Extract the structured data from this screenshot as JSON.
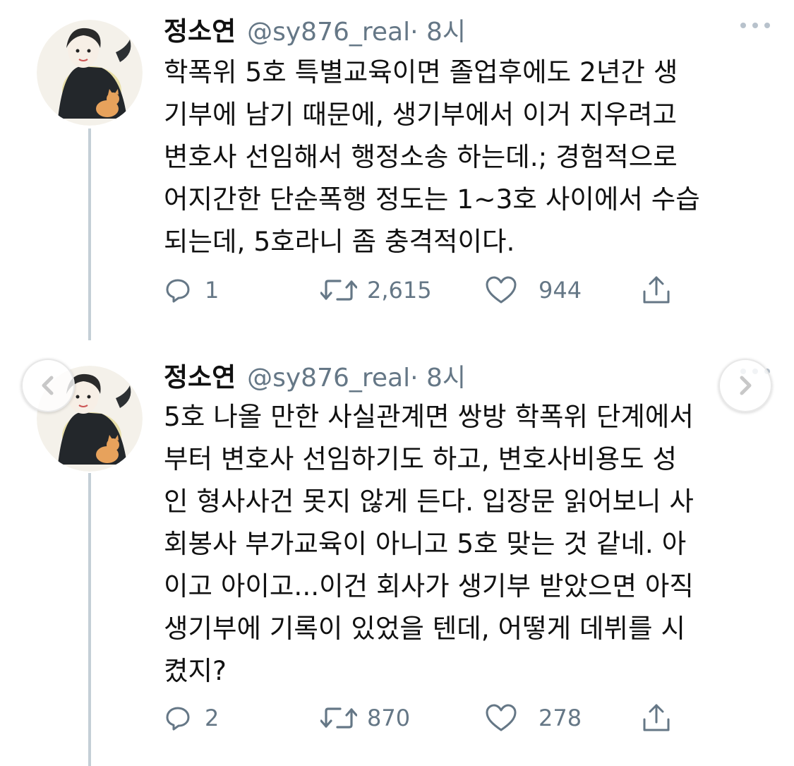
{
  "tweets": [
    {
      "display_name": "정소연",
      "handle": "@sy876_real",
      "time": " · 8시",
      "text": "학폭위 5호 특별교육이면 졸업후에도 2년간 생\n기부에 남기 때문에, 생기부에서 이거 지우려고\n변호사 선임해서 행정소송 하는데.; 경험적으로\n어지간한 단순폭행 정도는 1~3호 사이에서 수습\n되는데, 5호라니 좀 충격적이다.",
      "replies": "1",
      "retweets": "2,615",
      "likes": "944"
    },
    {
      "display_name": "정소연",
      "handle": "@sy876_real",
      "time": " · 8시",
      "text": "5호 나올 만한 사실관계면 쌍방 학폭위 단계에서\n부터 변호사 선임하기도 하고, 변호사비용도 성\n인 형사사건 못지 않게 든다. 입장문 읽어보니 사\n회봉사 부가교육이 아니고 5호 맞는 것 같네. 아\n이고 아이고...이건 회사가 생기부 받았으면 아직\n생기부에 기록이 있었을 텐데, 어떻게 데뷔를 시\n켰지?",
      "replies": "2",
      "retweets": "870",
      "likes": "278"
    }
  ],
  "icons": {
    "reply": "reply-icon",
    "retweet": "retweet-icon",
    "like": "like-icon",
    "share": "share-icon",
    "more": "more-icon",
    "carousel_prev": "chevron-left-icon",
    "carousel_next": "chevron-right-icon"
  },
  "colors": {
    "secondary_text": "#657786",
    "thread_line": "#c4cfd6",
    "icon": "#657786"
  }
}
